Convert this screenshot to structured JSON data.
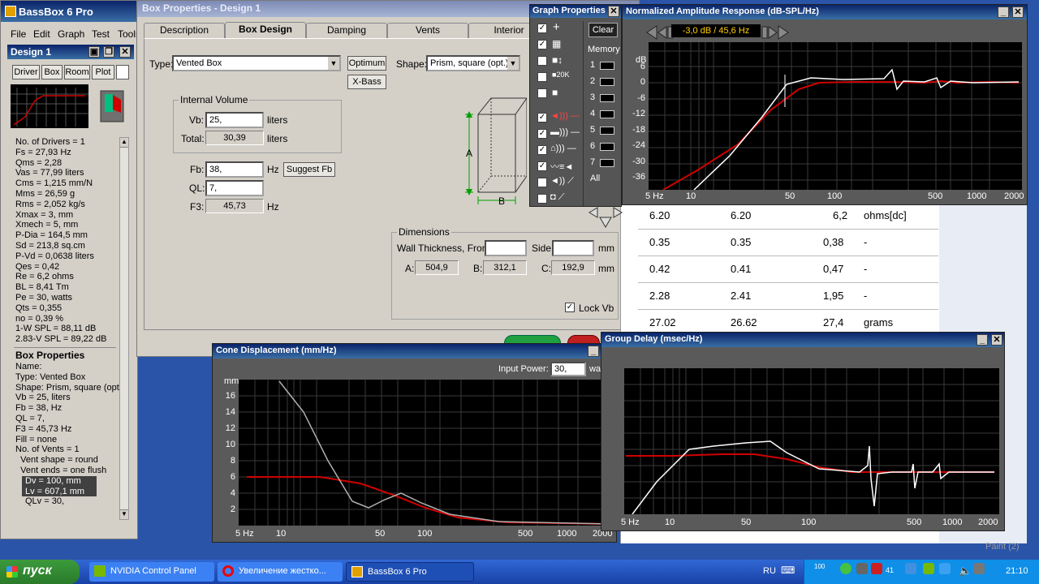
{
  "app": {
    "title": "BassBox 6 Pro",
    "menu": [
      "File",
      "Edit",
      "Graph",
      "Test",
      "Tools"
    ]
  },
  "design_panel": {
    "title": "Design 1",
    "tabs": [
      "Driver",
      "Box",
      "Room",
      "Plot"
    ],
    "params": [
      "No. of Drivers = 1",
      "Fs = 27,93 Hz",
      "Qms = 2,28",
      "Vas = 77,99 liters",
      "Cms = 1,215 mm/N",
      "Mms = 26,59 g",
      "Rms = 2,052 kg/s",
      "Xmax = 3, mm",
      "Xmech = 5, mm",
      "P-Dia = 164,5 mm",
      "Sd = 213,8 sq.cm",
      "P-Vd = 0,0638 liters",
      "Qes = 0,42",
      "Re = 6,2 ohms",
      "BL = 8,41 Tm",
      "Pe = 30, watts",
      "Qts = 0,355",
      "no = 0,39 %",
      "1-W SPL = 88,11 dB",
      "2.83-V SPL = 89,22 dB"
    ],
    "box_header": "Box Properties",
    "box_params": [
      "Name:",
      "Type: Vented Box",
      "Shape: Prism, square (opt",
      "Vb = 25, liters",
      "Fb = 38, Hz",
      "QL = 7,",
      "F3 = 45,73 Hz",
      "Fill = none",
      "No. of Vents = 1",
      "  Vent shape = round",
      "  Vent ends = one flush"
    ],
    "highlighted": [
      "Dv = 100, mm",
      "Lv = 607,1 mm"
    ],
    "last": "QLv = 30,"
  },
  "box_props": {
    "title": "Box Properties - Design 1",
    "tabs": [
      "Description",
      "Box Design",
      "Damping",
      "Vents",
      "Interior"
    ],
    "type_label": "Type:",
    "type_value": "Vented Box",
    "optimum": "Optimum",
    "xbass": "X-Bass",
    "shape_label": "Shape:",
    "shape_value": "Prism, square (opt.)",
    "internal_volume": "Internal Volume",
    "vb_label": "Vb:",
    "vb_value": "25,",
    "total_label": "Total:",
    "total_value": "30,39",
    "liters": "liters",
    "fb_label": "Fb:",
    "fb_value": "38,",
    "hz": "Hz",
    "suggest": "Suggest Fb",
    "ql_label": "QL:",
    "ql_value": "7,",
    "f3_label": "F3:",
    "f3_value": "45,73",
    "dimensions": "Dimensions",
    "wall": "Wall Thickness, Front:",
    "side": "Side:",
    "mm": "mm",
    "a_label": "A:",
    "a_value": "504,9",
    "b_label": "B:",
    "b_value": "312,1",
    "c_label": "C:",
    "c_value": "192,9",
    "lock_label": "Lock Vb",
    "dim_a": "A",
    "dim_b": "B"
  },
  "graph_props": {
    "title": "Graph Properties",
    "clear": "Clear",
    "memory": "Memory",
    "slots": [
      "1",
      "2",
      "3",
      "4",
      "5",
      "6",
      "7"
    ],
    "all": "All",
    "k20": "20K"
  },
  "amp": {
    "title": "Normalized Amplitude Response (dB-SPL/Hz)",
    "readout": "-3,0 dB / 45,6 Hz",
    "unit": "dB",
    "yticks": [
      "6",
      "0",
      "-6",
      "-12",
      "-18",
      "-24",
      "-30",
      "-36"
    ],
    "xticks": [
      "5 Hz",
      "10",
      "50",
      "100",
      "500",
      "1000",
      "2000"
    ]
  },
  "table": {
    "rows": [
      [
        "6.20",
        "6.20",
        "6,2",
        "ohms[dc]"
      ],
      [
        "0.35",
        "0.35",
        "0,38",
        "-"
      ],
      [
        "0.42",
        "0.41",
        "0,47",
        "-"
      ],
      [
        "2.28",
        "2.41",
        "1,95",
        "-"
      ],
      [
        "27.02",
        "26.62",
        "27,4",
        "grams"
      ]
    ]
  },
  "cone": {
    "title": "Cone Displacement (mm/Hz)",
    "input_power_label": "Input Power:",
    "input_power_value": "30,",
    "watts": "watts",
    "unit": "mm",
    "yticks": [
      "16",
      "14",
      "12",
      "10",
      "8",
      "6",
      "4",
      "2"
    ],
    "xticks": [
      "5 Hz",
      "10",
      "50",
      "100",
      "500",
      "1000",
      "2000"
    ]
  },
  "gd": {
    "title": "Group Delay (msec/Hz)",
    "xticks": [
      "5 Hz",
      "10",
      "50",
      "100",
      "500",
      "1000",
      "2000"
    ]
  },
  "taskbar": {
    "start": "пуск",
    "items": [
      "NVIDIA Control Panel",
      "Увеличение жестко...",
      "BassBox 6 Pro"
    ],
    "lang": "RU",
    "time": "21:10",
    "tray_num": "41",
    "tray_small": "100",
    "paint_label": "Paint (2)"
  },
  "colors": {
    "red_curve": "#d00000",
    "white_curve": "#ffffff",
    "plot_bg": "#000000"
  }
}
